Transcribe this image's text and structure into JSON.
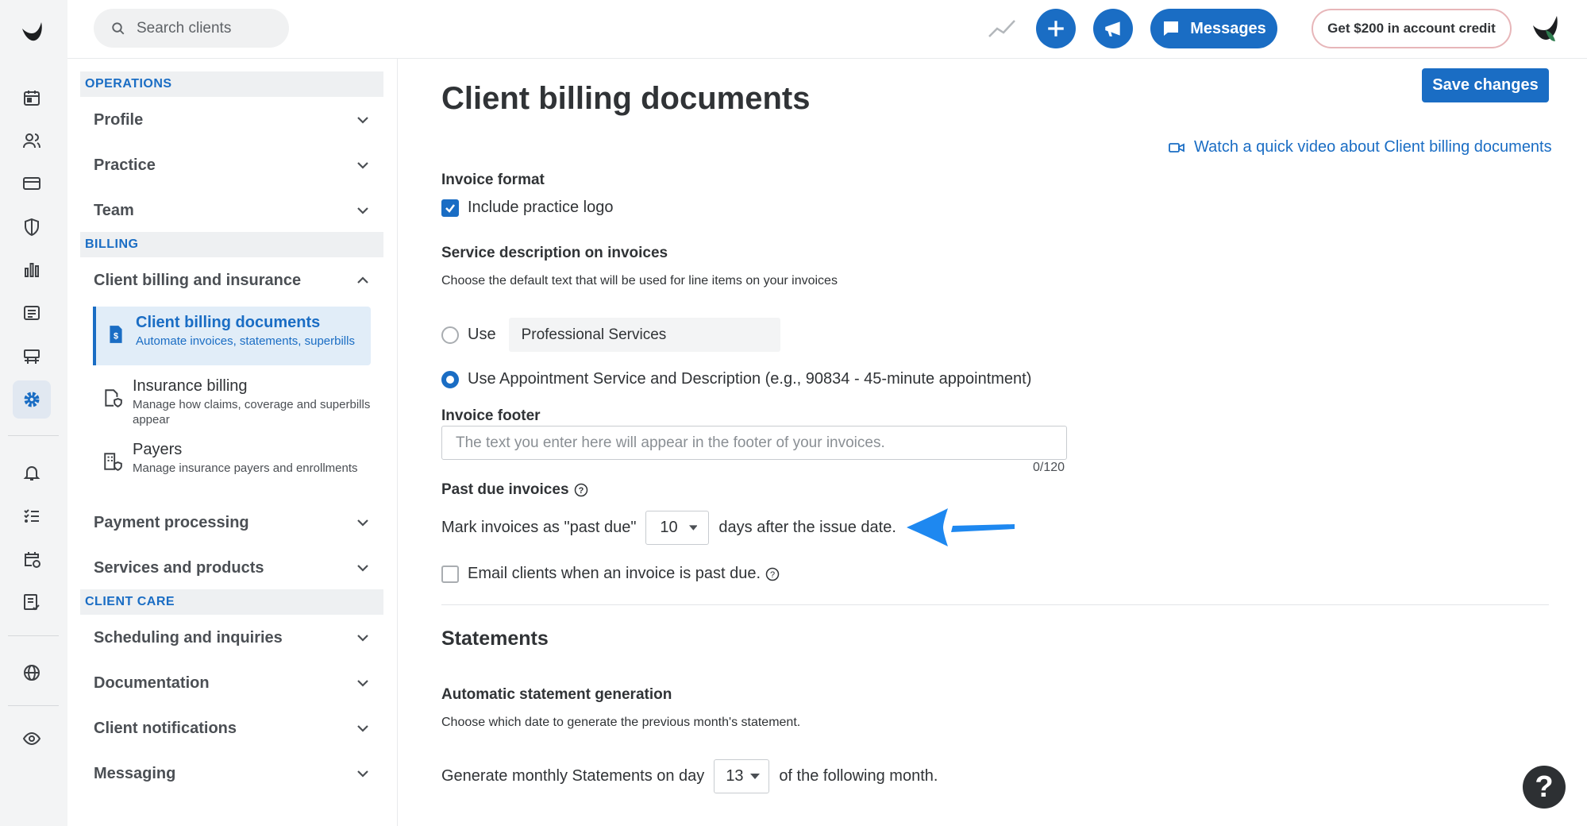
{
  "topbar": {
    "search_placeholder": "Search clients",
    "messages_label": "Messages",
    "credit_label": "Get $200 in account credit"
  },
  "nav": {
    "sections": {
      "operations": "OPERATIONS",
      "billing": "BILLING",
      "client_care": "CLIENT CARE"
    },
    "items": {
      "profile": "Profile",
      "practice": "Practice",
      "team": "Team",
      "client_billing_insurance": "Client billing and insurance",
      "payment_processing": "Payment processing",
      "services_products": "Services and products",
      "scheduling_inquiries": "Scheduling and inquiries",
      "documentation": "Documentation",
      "client_notifications": "Client notifications",
      "messaging": "Messaging"
    },
    "subitems": [
      {
        "title": "Client billing documents",
        "desc": "Automate invoices, statements, superbills"
      },
      {
        "title": "Insurance billing",
        "desc": "Manage how claims, coverage and superbills appear"
      },
      {
        "title": "Payers",
        "desc": "Manage insurance payers and enrollments"
      }
    ]
  },
  "main": {
    "title": "Client billing documents",
    "save_label": "Save changes",
    "video_link": "Watch a quick video about Client billing documents",
    "invoice_format": {
      "label": "Invoice format",
      "include_logo": "Include practice logo",
      "include_logo_checked": true
    },
    "service_description": {
      "label": "Service description on invoices",
      "help": "Choose the default text that will be used for line items on your invoices",
      "use_label": "Use",
      "custom_value": "Professional Services",
      "appointment_option": "Use Appointment Service and Description (e.g., 90834 - 45-minute appointment)",
      "selected": "appointment"
    },
    "invoice_footer": {
      "label": "Invoice footer",
      "placeholder": "The text you enter here will appear in the footer of your invoices.",
      "counter": "0/120"
    },
    "past_due": {
      "label": "Past due invoices",
      "prefix": "Mark invoices as \"past due\"",
      "days_value": "10",
      "suffix": "days after the issue date.",
      "email_label": "Email clients when an invoice is past due.",
      "email_checked": false
    },
    "statements": {
      "title": "Statements",
      "auto_label": "Automatic statement generation",
      "auto_help": "Choose which date to generate the previous month's statement.",
      "prefix": "Generate monthly Statements on day",
      "day_value": "13",
      "suffix": "of the following month."
    }
  },
  "help_bubble": "?",
  "colors": {
    "accent": "#1a6dc4",
    "arrow": "#1e88f0",
    "credit_border": "#e7b6b9"
  }
}
